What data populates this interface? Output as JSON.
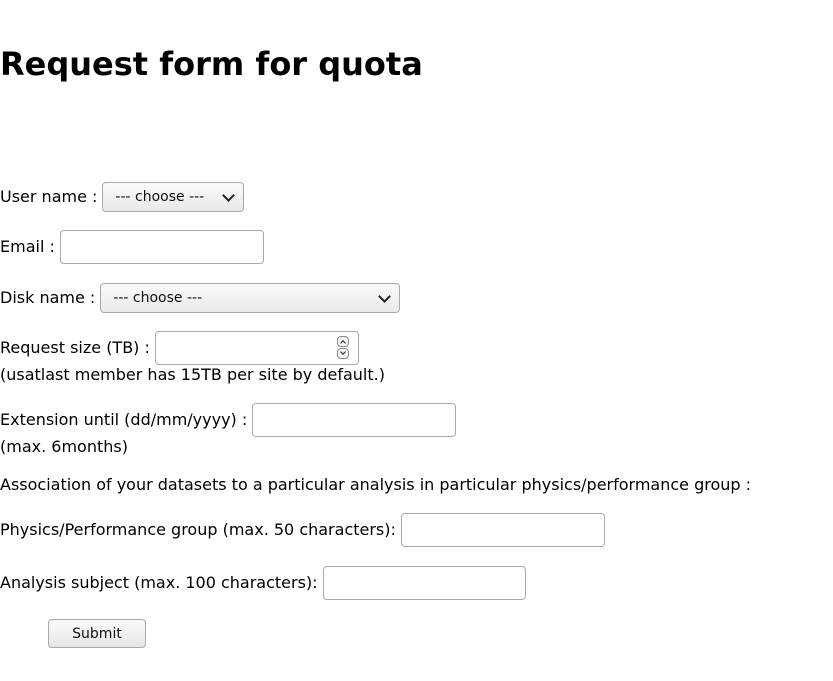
{
  "page": {
    "title": "Request form for quota"
  },
  "form": {
    "user_name": {
      "label": "User name :",
      "selected": "--- choose ---"
    },
    "email": {
      "label": "Email :",
      "value": ""
    },
    "disk_name": {
      "label": "Disk name :",
      "selected": "--- choose ---"
    },
    "request_size": {
      "label": "Request size (TB) :",
      "value": "",
      "note": "(usatlast member has 15TB per site by default.)"
    },
    "extension": {
      "label": "Extension until (dd/mm/yyyy) :",
      "value": "",
      "note": "(max. 6months)"
    },
    "association_text": "Association of your datasets to a particular analysis in particular physics/performance group :",
    "physics_group": {
      "label": "Physics/Performance group (max. 50 characters):",
      "value": ""
    },
    "analysis_subject": {
      "label": "Analysis subject (max. 100 characters):",
      "value": ""
    },
    "submit_label": "Submit"
  }
}
